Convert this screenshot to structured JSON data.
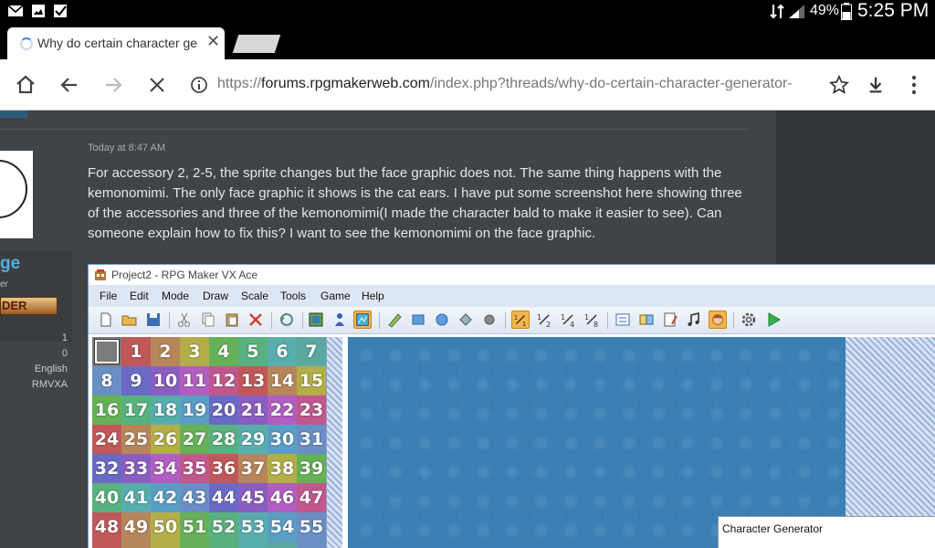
{
  "status_bar": {
    "battery_percent": "49%",
    "time": "5:25 PM",
    "left_icons": [
      "mail-icon",
      "image-icon",
      "checkbox-icon"
    ],
    "right_icons": [
      "data-transfer-icon",
      "signal-icon",
      "battery-icon"
    ]
  },
  "browser": {
    "tab_title": "Why do certain character ge",
    "url_scheme": "https://",
    "url_host": "forums.rpgmakerweb.com",
    "url_path": "/index.php?threads/why-do-certain-character-generator-"
  },
  "forum": {
    "username": "ge",
    "user_title": "er",
    "rank_badge": "DER",
    "stats": [
      "1",
      "0",
      "English",
      "RMVXA"
    ],
    "post_time": "Today at 8:47 AM",
    "post_text": "For accessory 2, 2-5, the sprite changes but the face graphic does not. The same thing happens with the kemonomimi. The only face graphic it shows is the cat ears. I have put some screenshot here showing three of the accessories and three of the kemonomimi(I made the character bald to make it easier to see). Can someone explain how to fix this? I want to see the kemonomimi on the face graphic."
  },
  "rpgmaker": {
    "window_title": "Project2 - RPG Maker VX Ace",
    "menu": [
      "File",
      "Edit",
      "Mode",
      "Draw",
      "Scale",
      "Tools",
      "Game",
      "Help"
    ],
    "tiles": [
      "",
      "1",
      "2",
      "3",
      "4",
      "5",
      "6",
      "7",
      "8",
      "9",
      "10",
      "11",
      "12",
      "13",
      "14",
      "15",
      "16",
      "17",
      "18",
      "19",
      "20",
      "21",
      "22",
      "23",
      "24",
      "25",
      "26",
      "27",
      "28",
      "29",
      "30",
      "31",
      "32",
      "33",
      "34",
      "35",
      "36",
      "37",
      "38",
      "39",
      "40",
      "41",
      "42",
      "43",
      "44",
      "45",
      "46",
      "47",
      "48",
      "49",
      "50",
      "51",
      "52",
      "53",
      "54",
      "55"
    ],
    "tile_colors": [
      "#7b7b7b",
      "#c0585a",
      "#b6865a",
      "#b3ae49",
      "#66b158",
      "#58b17e",
      "#5aadad",
      "#5aa8a0",
      "#6a8fc4",
      "#6a6ac4",
      "#8a5ec0",
      "#b05ec0",
      "#c0588e",
      "#c0585a",
      "#b6865a",
      "#b3ae49",
      "#66b158",
      "#58b17e",
      "#5aadad",
      "#5a9ec4",
      "#6a6ac4",
      "#8a5ec0",
      "#b05ec0",
      "#c0588e",
      "#c0585a",
      "#b6865a",
      "#b3ae49",
      "#66b158",
      "#58b17e",
      "#5aadad",
      "#5a9ec4",
      "#6a8fc4",
      "#6a6ac4",
      "#8a5ec0",
      "#b05ec0",
      "#c0588e",
      "#c0585a",
      "#b6865a",
      "#b3ae49",
      "#66b158",
      "#58b17e",
      "#5aadad",
      "#5a9ec4",
      "#6a8fc4",
      "#6a6ac4",
      "#8a5ec0",
      "#b05ec0",
      "#c0588e",
      "#c0585a",
      "#b6865a",
      "#b3ae49",
      "#66b158",
      "#58b17e",
      "#5aadad",
      "#5a9ec4",
      "#6a8fc4"
    ],
    "character_generator_title": "Character Generator"
  }
}
